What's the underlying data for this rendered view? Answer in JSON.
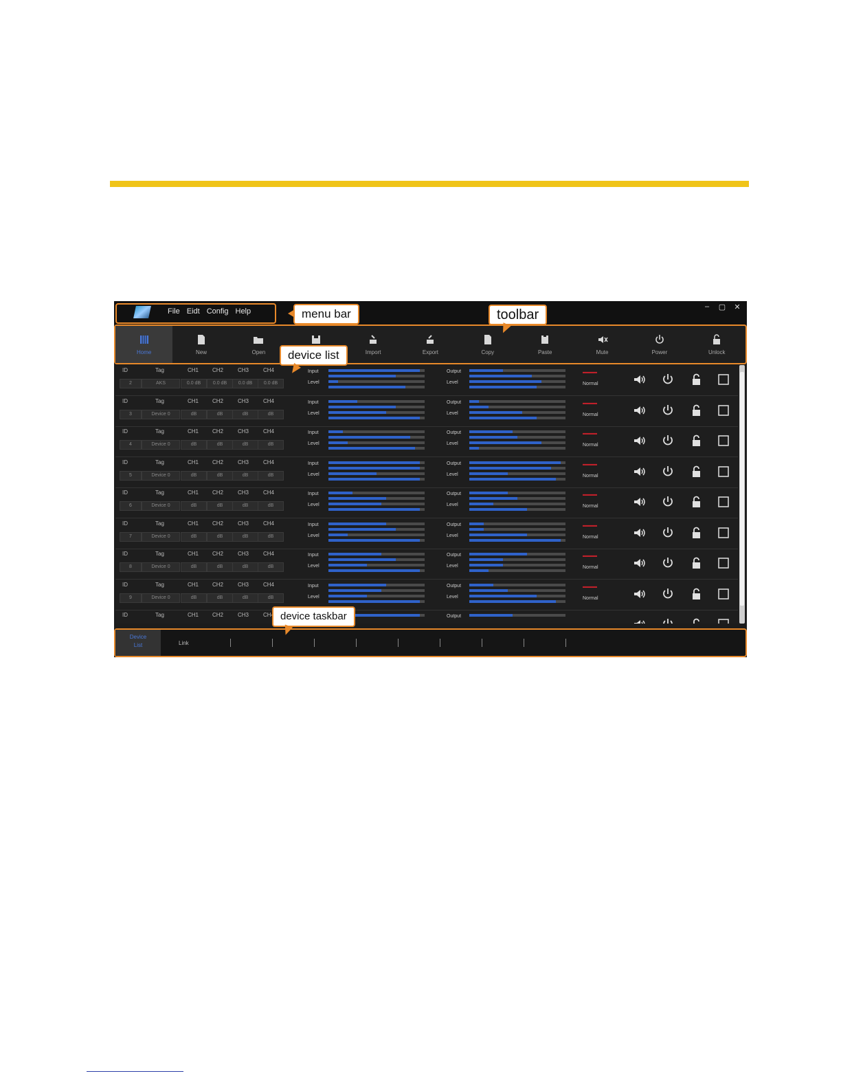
{
  "menu": {
    "items": [
      "File",
      "Eidt",
      "Config",
      "Help"
    ],
    "window_controls": [
      "–",
      "▢",
      "✕"
    ]
  },
  "callouts": {
    "menu_bar": "menu bar",
    "toolbar": "toolbar",
    "device_list": "device list",
    "device_taskbar": "device taskbar"
  },
  "toolbar": {
    "items": [
      "Home",
      "New",
      "Open",
      "Save",
      "Import",
      "Export",
      "Copy",
      "Paste",
      "Mute",
      "Power",
      "Unlock"
    ],
    "active_index": 0,
    "accent": "#4a78d8"
  },
  "device_list": {
    "headers": {
      "id": "ID",
      "tag": "Tag",
      "ch1": "CH1",
      "ch2": "CH2",
      "ch3": "CH3",
      "ch4": "CH4"
    },
    "labels": {
      "input": "Input",
      "output": "Output",
      "level": "Level"
    },
    "rows": [
      {
        "id": "2",
        "tag": "AKS",
        "ch": [
          "0.0 dB",
          "0.0 dB",
          "0.0 dB",
          "0.0 dB"
        ],
        "status": "Normal",
        "meters_in": [
          0.95,
          0.7,
          0.1,
          0.8
        ],
        "meters_out": [
          0.35,
          0.65,
          0.75,
          0.7
        ]
      },
      {
        "id": "3",
        "tag": "Device 0",
        "ch": [
          "dB",
          "dB",
          "dB",
          "dB"
        ],
        "status": "Normal",
        "meters_in": [
          0.3,
          0.7,
          0.6,
          0.95
        ],
        "meters_out": [
          0.1,
          0.2,
          0.55,
          0.7
        ]
      },
      {
        "id": "4",
        "tag": "Device 0",
        "ch": [
          "dB",
          "dB",
          "dB",
          "dB"
        ],
        "status": "Normal",
        "meters_in": [
          0.15,
          0.85,
          0.2,
          0.9
        ],
        "meters_out": [
          0.45,
          0.5,
          0.75,
          0.1
        ]
      },
      {
        "id": "5",
        "tag": "Device 0",
        "ch": [
          "dB",
          "dB",
          "dB",
          "dB"
        ],
        "status": "Normal",
        "meters_in": [
          0.95,
          0.95,
          0.5,
          0.95
        ],
        "meters_out": [
          0.95,
          0.85,
          0.4,
          0.9
        ]
      },
      {
        "id": "6",
        "tag": "Device 0",
        "ch": [
          "dB",
          "dB",
          "dB",
          "dB"
        ],
        "status": "Normal",
        "meters_in": [
          0.25,
          0.6,
          0.55,
          0.95
        ],
        "meters_out": [
          0.4,
          0.5,
          0.25,
          0.6
        ]
      },
      {
        "id": "7",
        "tag": "Device 0",
        "ch": [
          "dB",
          "dB",
          "dB",
          "dB"
        ],
        "status": "Normal",
        "meters_in": [
          0.6,
          0.7,
          0.2,
          0.95
        ],
        "meters_out": [
          0.15,
          0.15,
          0.6,
          0.95
        ]
      },
      {
        "id": "8",
        "tag": "Device 0",
        "ch": [
          "dB",
          "dB",
          "dB",
          "dB"
        ],
        "status": "Normal",
        "meters_in": [
          0.55,
          0.7,
          0.4,
          0.95
        ],
        "meters_out": [
          0.6,
          0.35,
          0.35,
          0.2
        ]
      },
      {
        "id": "9",
        "tag": "Device 0",
        "ch": [
          "dB",
          "dB",
          "dB",
          "dB"
        ],
        "status": "Normal",
        "meters_in": [
          0.6,
          0.55,
          0.4,
          0.95
        ],
        "meters_out": [
          0.25,
          0.4,
          0.7,
          0.9
        ]
      },
      {
        "id": "",
        "tag": "",
        "ch": [
          "",
          "",
          "",
          ""
        ],
        "status": "",
        "meters_in": [
          0.95
        ],
        "meters_out": [
          0.45
        ]
      }
    ],
    "row_icons": [
      "speaker-icon",
      "power-icon",
      "unlock-icon",
      "checkbox-icon"
    ],
    "status_color": "#c0202a"
  },
  "taskbar": {
    "device_line1": "Device",
    "device_line2": "List",
    "link": "Link"
  }
}
